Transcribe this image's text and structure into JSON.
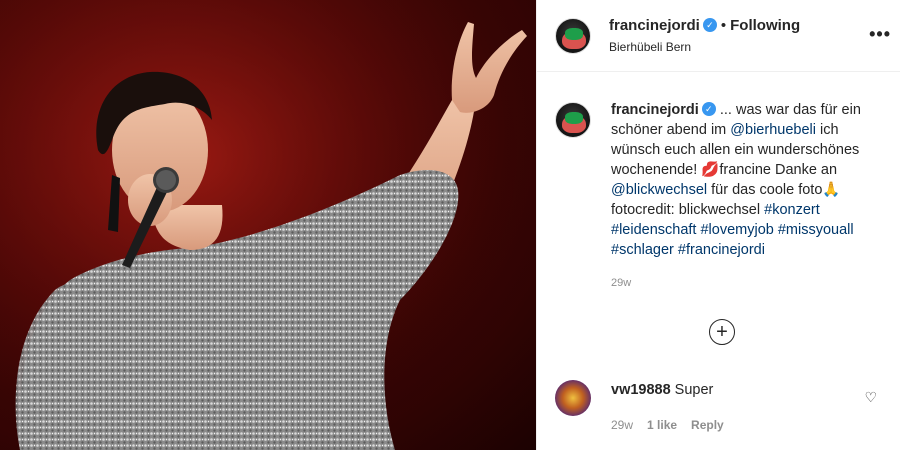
{
  "post": {
    "username": "francinejordi",
    "verified_mark": "✓",
    "follow_state": "Following",
    "location": "Bierhübeli Bern",
    "more_icon": "more-options-icon",
    "photo": {
      "subject": "singer-performing-photo",
      "background_color": "#5e0b08",
      "outfit_color": "#9a9a9a"
    }
  },
  "caption": {
    "username": "francinejordi",
    "text_1": " ... was war das für ein schöner abend im ",
    "mention_1": "@bierhuebeli",
    "text_2": " ich wünsch euch allen ein wunderschönes wochenende! ",
    "emoji_lips": "💋",
    "text_3": "francine Danke an ",
    "mention_2": "@blickwechsel",
    "text_4": " für das coole foto",
    "emoji_hands": "🙏",
    "text_5": " fotocredit: blickwechsel ",
    "hashtags": [
      "#konzert",
      "#leidenschaft",
      "#lovemyjob",
      "#missyouall",
      "#schlager",
      "#francinejordi"
    ],
    "time": "29w"
  },
  "add_comment_icon": "+",
  "comments": [
    {
      "username": "vw19888",
      "text": "Super",
      "time": "29w",
      "likes": "1 like",
      "reply": "Reply"
    }
  ],
  "colors": {
    "link": "#00376b",
    "muted": "#8e8e8e",
    "verified": "#3897f0"
  }
}
